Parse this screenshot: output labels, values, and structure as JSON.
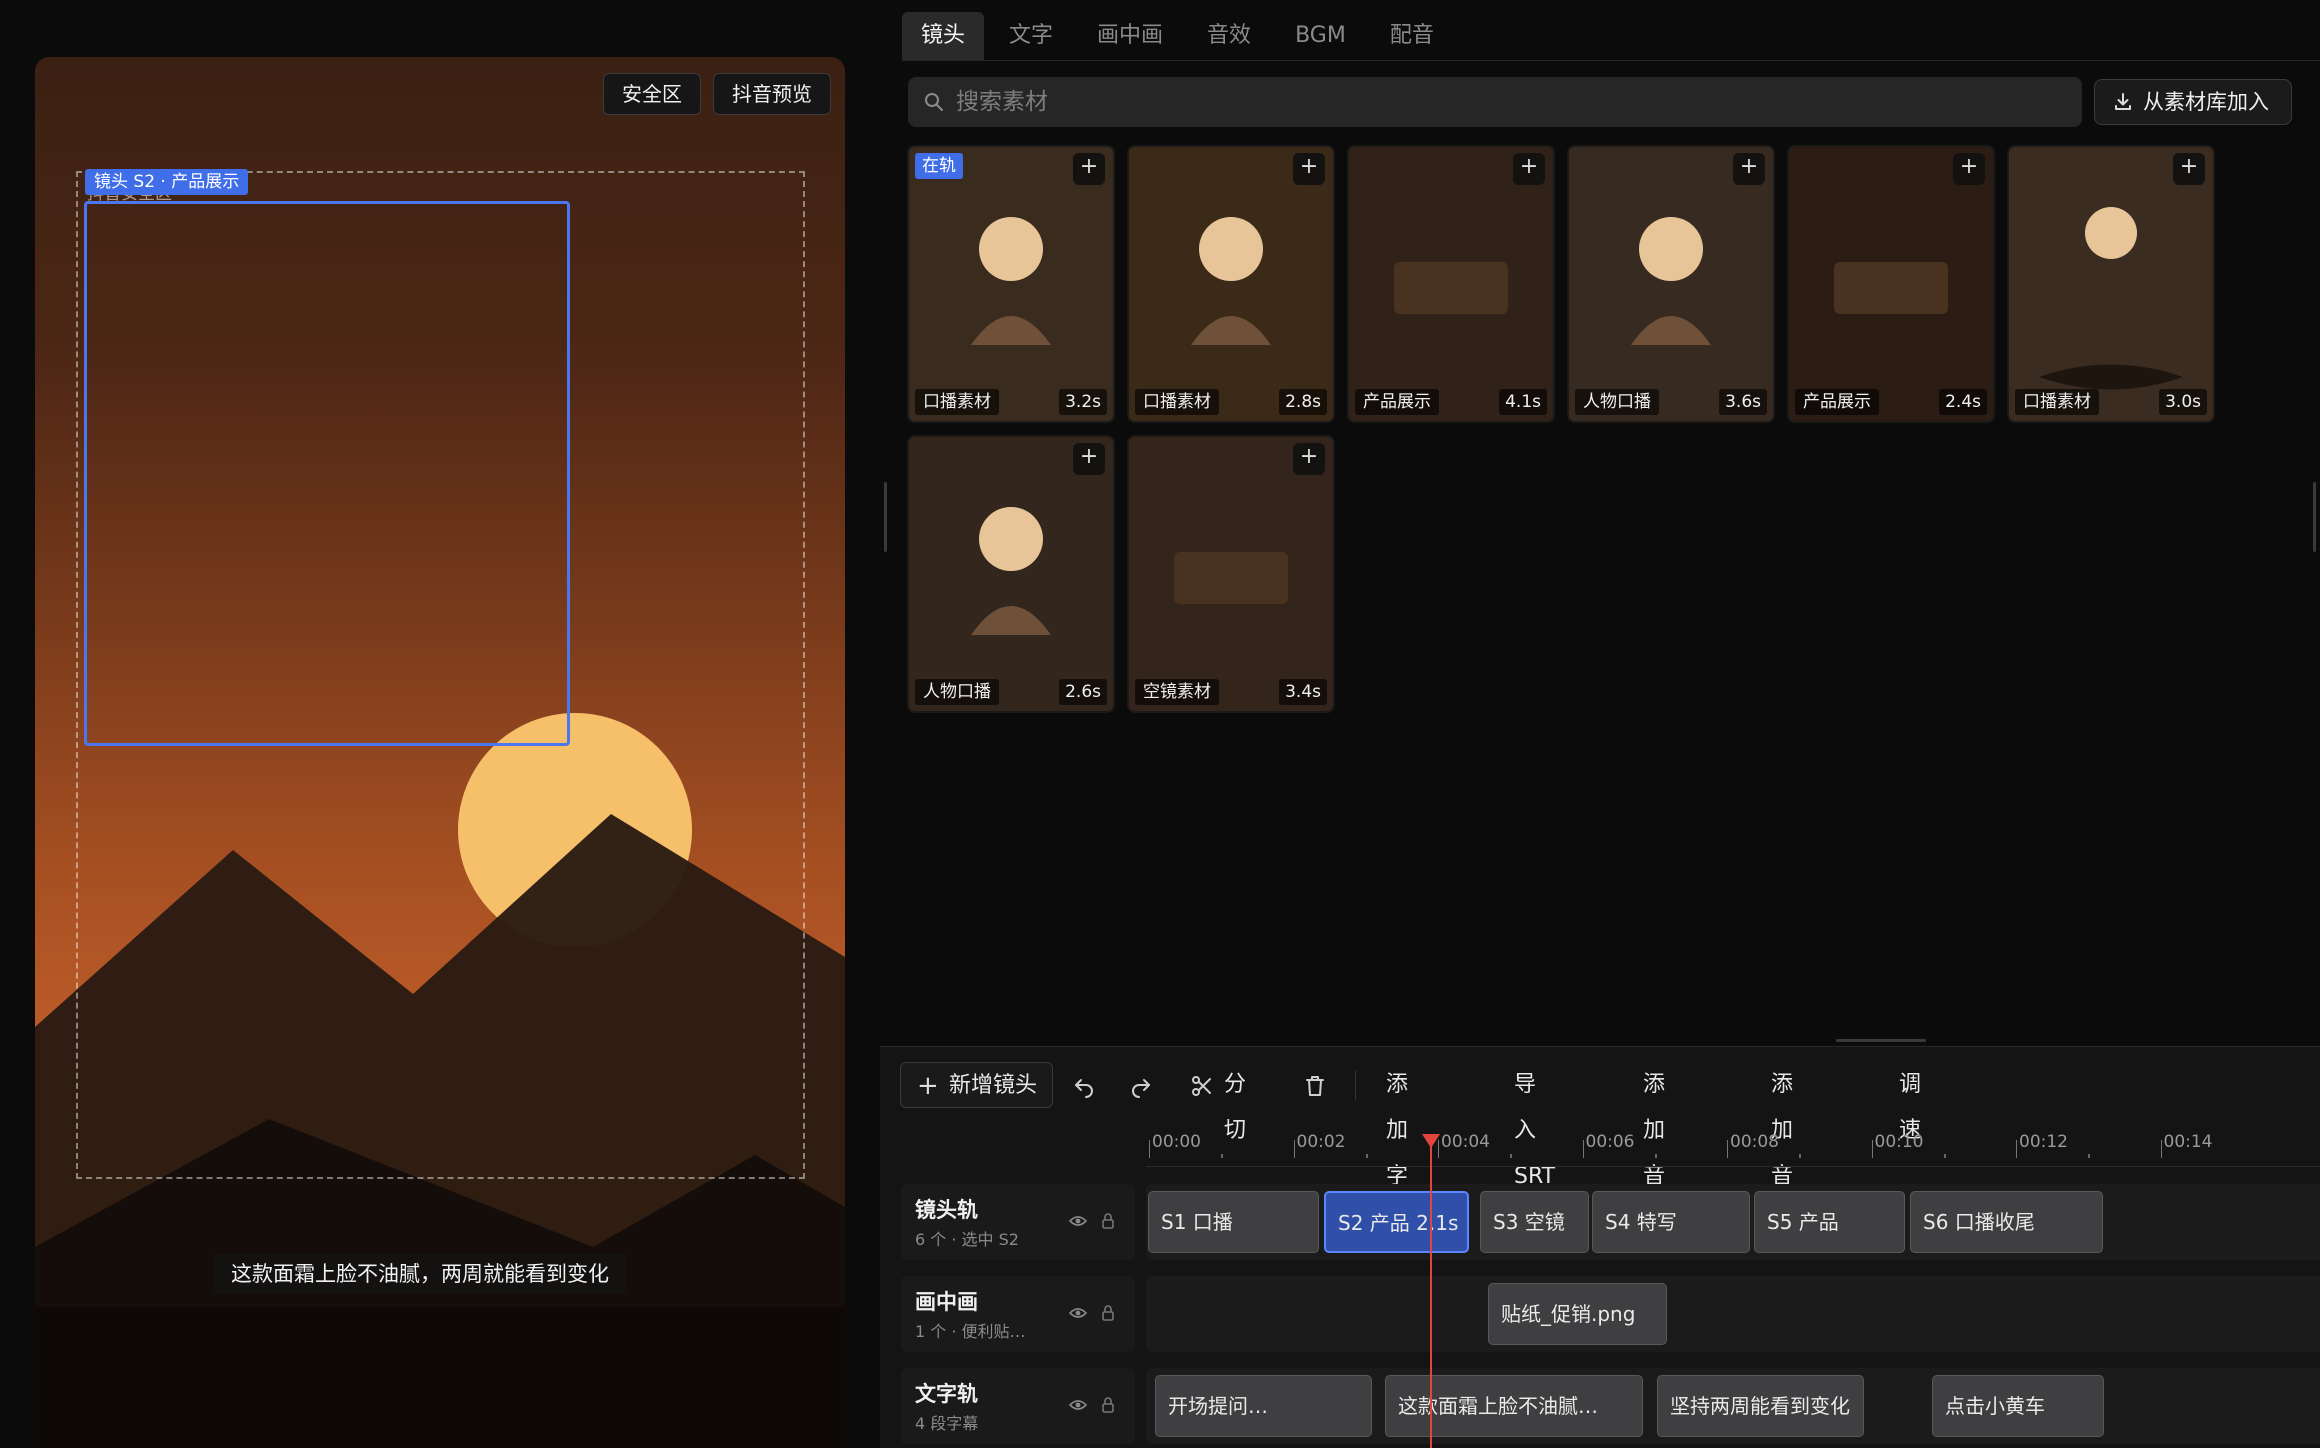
{
  "preview": {
    "safe_zone_button": "安全区",
    "douyin_preview_button": "抖音预览",
    "safe_zone_label": "抖音安全区",
    "selection_tag": "镜头 S2 · 产品展示",
    "subtitle": "这款面霜上脸不油腻，两周就能看到变化",
    "colors": {
      "sun": "#f6c06a",
      "mountain_near": "#2a1a12",
      "selection": "#4a76f0"
    }
  },
  "tabs": [
    {
      "label": "镜头",
      "active": true
    },
    {
      "label": "文字"
    },
    {
      "label": "画中画"
    },
    {
      "label": "音效"
    },
    {
      "label": "BGM"
    },
    {
      "label": "配音"
    }
  ],
  "search": {
    "placeholder": "搜索素材",
    "value": ""
  },
  "library_button": "从素材库加入",
  "assets": [
    {
      "name": "口播素材",
      "duration": "3.2s",
      "badge": "在轨",
      "thumb": "person",
      "bg": "#3a2b1f"
    },
    {
      "name": "口播素材",
      "duration": "2.8s",
      "thumb": "person",
      "bg": "#3b2a17"
    },
    {
      "name": "产品展示",
      "duration": "4.1s",
      "thumb": "product",
      "bg": "#302219"
    },
    {
      "name": "人物口播",
      "duration": "3.6s",
      "thumb": "person",
      "bg": "#372b21"
    },
    {
      "name": "产品展示",
      "duration": "2.4s",
      "thumb": "product",
      "bg": "#2b1d14"
    },
    {
      "name": "口播素材",
      "duration": "3.0s",
      "thumb": "person-lying",
      "bg": "#3a2c20"
    },
    {
      "name": "人物口播",
      "duration": "2.6s",
      "thumb": "person",
      "bg": "#33261c"
    },
    {
      "name": "空镜素材",
      "duration": "3.4s",
      "thumb": "product",
      "bg": "#33251b"
    }
  ],
  "toolbar": {
    "add_shot": "新增镜头",
    "split": "分切",
    "add_subtitle": "添加字幕",
    "import_srt": "导入 SRT",
    "add_audio": "添加音频",
    "add_sfx": "添加音效",
    "speed": "调速"
  },
  "ruler": {
    "labels": [
      "00:00",
      "00:02",
      "00:04",
      "00:06",
      "00:08",
      "00:10",
      "00:12",
      "00:14"
    ]
  },
  "tracks": [
    {
      "name": "镜头轨",
      "sub": "6 个 · 选中 S2",
      "clips": [
        {
          "label": "S1 口播"
        },
        {
          "label": "S2 产品 2.1s",
          "selected": true
        },
        {
          "label": "S3 空镜"
        },
        {
          "label": "S4 特写"
        },
        {
          "label": "S5 产品"
        },
        {
          "label": "S6 口播收尾"
        }
      ]
    },
    {
      "name": "画中画",
      "sub": "1 个 · 便利贴…",
      "clips": [
        {
          "label": "贴纸_促销.png"
        }
      ]
    },
    {
      "name": "文字轨",
      "sub": "4 段字幕",
      "clips": [
        {
          "label": "开场提问…"
        },
        {
          "label": "这款面霜上脸不油腻…"
        },
        {
          "label": "坚持两周能看到变化"
        },
        {
          "label": "点击小黄车"
        }
      ]
    }
  ]
}
